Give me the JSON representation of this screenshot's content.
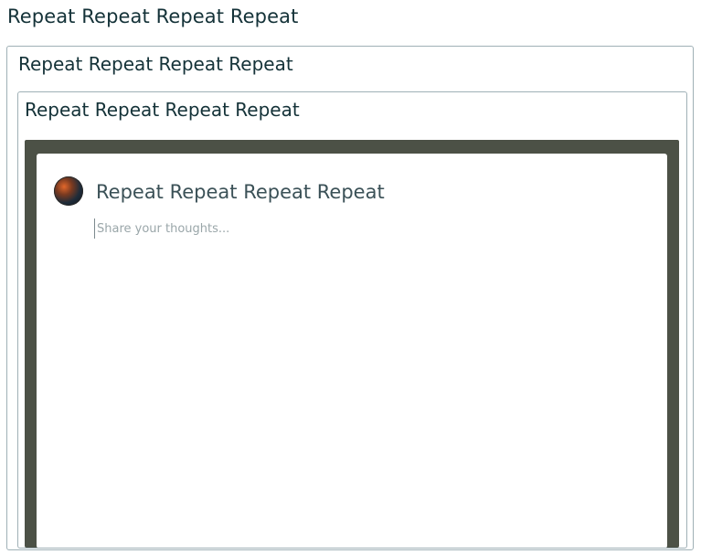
{
  "header": {
    "title": "Repeat Repeat Repeat Repeat"
  },
  "outer_panel": {
    "title": "Repeat Repeat Repeat Repeat"
  },
  "inner_panel": {
    "title": "Repeat Repeat Repeat Repeat"
  },
  "composer": {
    "author_name": "Repeat Repeat Repeat Repeat",
    "input": {
      "value": "",
      "placeholder": "Share your thoughts..."
    },
    "avatar_icon": "user-avatar-icon"
  },
  "colors": {
    "title_text": "#143238",
    "panel_border": "#9fb0b6",
    "frame_background": "#4c5146"
  }
}
